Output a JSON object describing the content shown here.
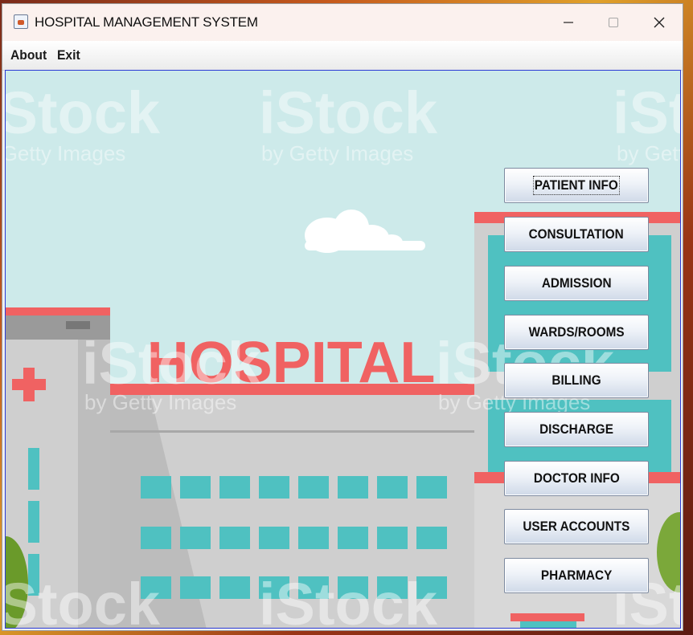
{
  "window": {
    "title": "HOSPITAL MANAGEMENT SYSTEM",
    "controls": {
      "minimize": "—",
      "maximize": "☐",
      "close": "✕"
    }
  },
  "menu": {
    "items": [
      "About",
      "Exit"
    ]
  },
  "background": {
    "sign_text": "HOSPITAL",
    "watermarks": [
      "iStock",
      "by Getty Images"
    ],
    "colors": {
      "sky": "#cdeaea",
      "sign": "#f06262",
      "building": "#c9c9c9",
      "windows": "#4fc1c1"
    }
  },
  "nav": {
    "buttons": [
      "PATIENT INFO",
      "CONSULTATION",
      "ADMISSION",
      "WARDS/ROOMS",
      "BILLING",
      "DISCHARGE",
      "DOCTOR INFO",
      "USER ACCOUNTS",
      "PHARMACY"
    ]
  },
  "accent": "#2b3bd6"
}
